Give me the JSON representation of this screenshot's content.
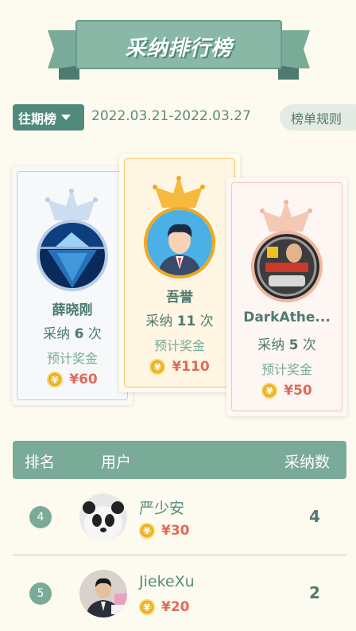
{
  "title": "采纳排行榜",
  "period": {
    "label": "往期榜",
    "date_range": "2022.03.21-2022.03.27"
  },
  "rules_label": "榜单规则",
  "podium": [
    {
      "rank": 2,
      "name": "薛晓刚",
      "times_prefix": "采纳",
      "count": "6",
      "times_suffix": "次",
      "prize_label": "预计奖金",
      "coin_symbol": "¥",
      "prize": "¥60",
      "crown_color": "#b8cde8"
    },
    {
      "rank": 1,
      "name": "吾誉",
      "times_prefix": "采纳",
      "count": "11",
      "times_suffix": "次",
      "prize_label": "预计奖金",
      "coin_symbol": "¥",
      "prize": "¥110",
      "crown_color": "#f5b940"
    },
    {
      "rank": 3,
      "name": "DarkAthe...",
      "times_prefix": "采纳",
      "count": "5",
      "times_suffix": "次",
      "prize_label": "预计奖金",
      "coin_symbol": "¥",
      "prize": "¥50",
      "crown_color": "#f0b89e"
    }
  ],
  "table": {
    "headers": {
      "rank": "排名",
      "user": "用户",
      "count": "采纳数"
    },
    "rows": [
      {
        "rank": "4",
        "name": "严少安",
        "coin_symbol": "¥",
        "prize": "¥30",
        "count": "4"
      },
      {
        "rank": "5",
        "name": "JiekeXu",
        "coin_symbol": "¥",
        "prize": "¥20",
        "count": "2"
      }
    ]
  },
  "colors": {
    "accent": "#7aaa98",
    "dark_accent": "#4f8a7c",
    "background": "#fdfbef",
    "prize_red": "#e06a5a",
    "gold": "#f2c240"
  }
}
